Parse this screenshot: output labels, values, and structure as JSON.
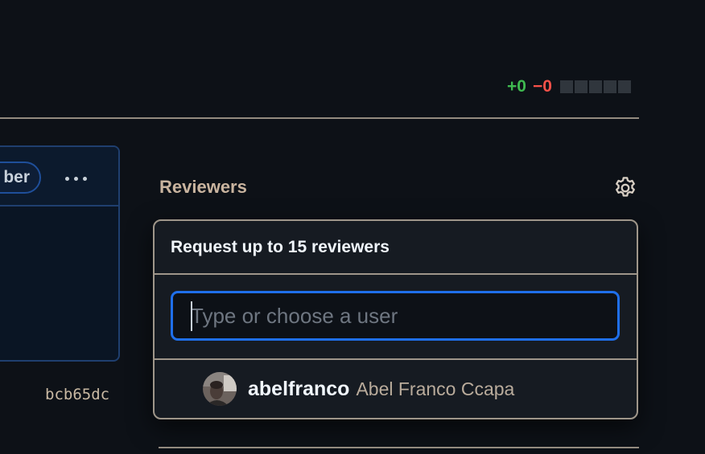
{
  "diffstat": {
    "additions": "+0",
    "deletions": "−0",
    "squares": 5
  },
  "left_card": {
    "pill_label": "ber",
    "more_label": "More actions"
  },
  "commit_sha": "bcb65dc",
  "reviewers": {
    "label": "Reviewers",
    "settings_icon": "gear-icon"
  },
  "reviewer_popover": {
    "title": "Request up to 15 reviewers",
    "filter": {
      "value": "",
      "placeholder": "Type or choose a user"
    },
    "suggestions": [
      {
        "login": "abelfranco",
        "name": "Abel Franco Ccapa",
        "avatar": "user-avatar"
      }
    ]
  },
  "colors": {
    "background": "#0d1117",
    "additions": "#3fb950",
    "deletions": "#f85149",
    "focus_ring": "#1f6feb"
  }
}
